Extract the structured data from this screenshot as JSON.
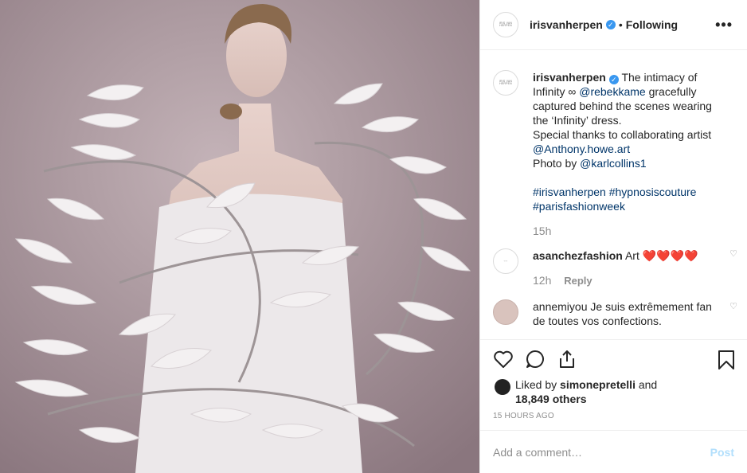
{
  "header": {
    "username": "irisvanherpen",
    "avatar_text": "IRIS VAN HERPEN",
    "separator": "•",
    "follow_status": "Following",
    "more_icon": "more-horizontal-icon"
  },
  "caption": {
    "username": "irisvanherpen",
    "line1": "The intimacy of Infinity ∞ ",
    "mention1": "@rebekkame",
    "line2": " gracefully captured behind the scenes wearing the ‘Infinity’ dress.",
    "line3": "Special thanks to collaborating artist",
    "mention2": "@Anthony.howe.art",
    "line4": "Photo by ",
    "mention3": "@karlcollins1",
    "hashtag1": "#irisvanherpen",
    "hashtag2": "#hypnosiscouture",
    "hashtag3": "#parisfashionweek",
    "time": "15h"
  },
  "comments": [
    {
      "username": "asanchezfashion",
      "text": "Art ❤️❤️❤️❤️",
      "time": "12h",
      "reply": "Reply"
    },
    {
      "username": "annemiyou",
      "text": "Je suis extrêmement fan de toutes vos confections."
    }
  ],
  "likes": {
    "prefix": "Liked by ",
    "user": "simonepretelli",
    "suffix": " and",
    "others": "18,849 others"
  },
  "timestamp": "15 HOURS AGO",
  "add_comment": {
    "placeholder": "Add a comment…",
    "post_label": "Post"
  },
  "colors": {
    "verified": "#3897f0",
    "link": "#003569",
    "post_disabled": "#b2dffc"
  }
}
